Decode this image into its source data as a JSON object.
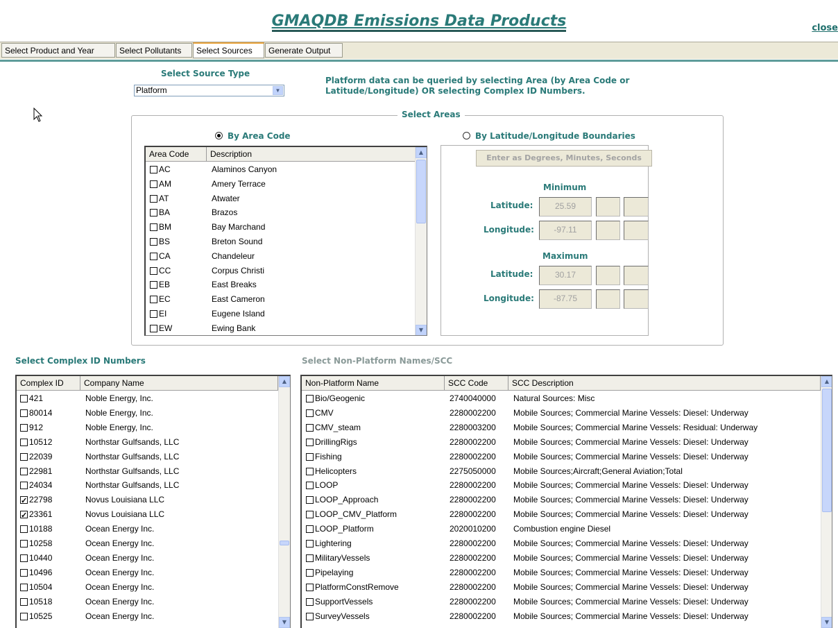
{
  "page_title": "GMAQDB Emissions Data Products",
  "close_label": "close",
  "tabs": [
    "Select Product and Year",
    "Select Pollutants",
    "Select Sources",
    "Generate Output"
  ],
  "active_tab": "Select Sources",
  "source_type": {
    "label": "Select Source Type",
    "value": "Platform"
  },
  "info_text_line1": "Platform data can be queried by selecting Area (by Area Code or",
  "info_text_line2": "Latitude/Longitude) OR selecting Complex ID Numbers.",
  "select_areas": {
    "legend": "Select Areas",
    "by_area_code_label": "By Area Code",
    "by_latlon_label": "By Latitude/Longitude Boundaries",
    "selected_mode": "By Area Code",
    "columns": [
      "Area Code",
      "Description"
    ],
    "rows": [
      {
        "code": "AC",
        "desc": "Alaminos Canyon"
      },
      {
        "code": "AM",
        "desc": "Amery Terrace"
      },
      {
        "code": "AT",
        "desc": "Atwater"
      },
      {
        "code": "BA",
        "desc": "Brazos"
      },
      {
        "code": "BM",
        "desc": "Bay Marchand"
      },
      {
        "code": "BS",
        "desc": "Breton Sound"
      },
      {
        "code": "CA",
        "desc": "Chandeleur"
      },
      {
        "code": "CC",
        "desc": "Corpus Christi"
      },
      {
        "code": "EB",
        "desc": "East Breaks"
      },
      {
        "code": "EC",
        "desc": "East Cameron"
      },
      {
        "code": "EI",
        "desc": "Eugene Island"
      },
      {
        "code": "EW",
        "desc": "Ewing Bank"
      }
    ]
  },
  "latlon": {
    "button_label": "Enter as Degrees, Minutes, Seconds",
    "minimum_label": "Minimum",
    "maximum_label": "Maximum",
    "latitude_label": "Latitude:",
    "longitude_label": "Longitude:",
    "min_latitude": "25.59",
    "min_longitude": "-97.11",
    "max_latitude": "30.17",
    "max_longitude": "-87.75"
  },
  "complex_section": {
    "label": "Select Complex ID Numbers",
    "columns": [
      "Complex ID",
      "Company Name"
    ],
    "rows": [
      {
        "id": "421",
        "company": "Noble Energy, Inc.",
        "checked": false
      },
      {
        "id": "80014",
        "company": "Noble Energy, Inc.",
        "checked": false
      },
      {
        "id": "912",
        "company": "Noble Energy, Inc.",
        "checked": false
      },
      {
        "id": "10512",
        "company": "Northstar Gulfsands, LLC",
        "checked": false
      },
      {
        "id": "22039",
        "company": "Northstar Gulfsands, LLC",
        "checked": false
      },
      {
        "id": "22981",
        "company": "Northstar Gulfsands, LLC",
        "checked": false
      },
      {
        "id": "24034",
        "company": "Northstar Gulfsands, LLC",
        "checked": false
      },
      {
        "id": "22798",
        "company": "Novus Louisiana LLC",
        "checked": true
      },
      {
        "id": "23361",
        "company": "Novus Louisiana LLC",
        "checked": true
      },
      {
        "id": "10188",
        "company": "Ocean Energy Inc.",
        "checked": false
      },
      {
        "id": "10258",
        "company": "Ocean Energy Inc.",
        "checked": false
      },
      {
        "id": "10440",
        "company": "Ocean Energy Inc.",
        "checked": false
      },
      {
        "id": "10496",
        "company": "Ocean Energy Inc.",
        "checked": false
      },
      {
        "id": "10504",
        "company": "Ocean Energy Inc.",
        "checked": false
      },
      {
        "id": "10518",
        "company": "Ocean Energy Inc.",
        "checked": false
      },
      {
        "id": "10525",
        "company": "Ocean Energy Inc.",
        "checked": false
      }
    ]
  },
  "nonplatform_section": {
    "label": "Select Non-Platform Names/SCC",
    "columns": [
      "Non-Platform Name",
      "SCC Code",
      "SCC Description"
    ],
    "rows": [
      {
        "name": "Bio/Geogenic",
        "scc": "2740040000",
        "desc": "Natural Sources: Misc"
      },
      {
        "name": "CMV",
        "scc": "2280002200",
        "desc": "Mobile Sources; Commercial Marine Vessels: Diesel: Underway"
      },
      {
        "name": "CMV_steam",
        "scc": "2280003200",
        "desc": "Mobile Sources; Commercial Marine Vessels: Residual: Underway"
      },
      {
        "name": "DrillingRigs",
        "scc": "2280002200",
        "desc": "Mobile Sources; Commercial Marine Vessels: Diesel: Underway"
      },
      {
        "name": "Fishing",
        "scc": "2280002200",
        "desc": "Mobile Sources; Commercial Marine Vessels: Diesel: Underway"
      },
      {
        "name": "Helicopters",
        "scc": "2275050000",
        "desc": "Mobile Sources;Aircraft;General Aviation;Total"
      },
      {
        "name": "LOOP",
        "scc": "2280002200",
        "desc": "Mobile Sources; Commercial Marine Vessels: Diesel: Underway"
      },
      {
        "name": "LOOP_Approach",
        "scc": "2280002200",
        "desc": "Mobile Sources; Commercial Marine Vessels: Diesel: Underway"
      },
      {
        "name": "LOOP_CMV_Platform",
        "scc": "2280002200",
        "desc": "Mobile Sources; Commercial Marine Vessels: Diesel: Underway"
      },
      {
        "name": "LOOP_Platform",
        "scc": "2020010200",
        "desc": "Combustion engine Diesel"
      },
      {
        "name": "Lightering",
        "scc": "2280002200",
        "desc": "Mobile Sources; Commercial Marine Vessels: Diesel: Underway"
      },
      {
        "name": "MilitaryVessels",
        "scc": "2280002200",
        "desc": "Mobile Sources; Commercial Marine Vessels: Diesel: Underway"
      },
      {
        "name": "Pipelaying",
        "scc": "2280002200",
        "desc": "Mobile Sources; Commercial Marine Vessels: Diesel: Underway"
      },
      {
        "name": "PlatformConstRemove",
        "scc": "2280002200",
        "desc": "Mobile Sources; Commercial Marine Vessels: Diesel: Underway"
      },
      {
        "name": "SupportVessels",
        "scc": "2280002200",
        "desc": "Mobile Sources; Commercial Marine Vessels: Diesel: Underway"
      },
      {
        "name": "SurveyVessels",
        "scc": "2280002200",
        "desc": "Mobile Sources; Commercial Marine Vessels: Diesel: Underway"
      }
    ]
  }
}
